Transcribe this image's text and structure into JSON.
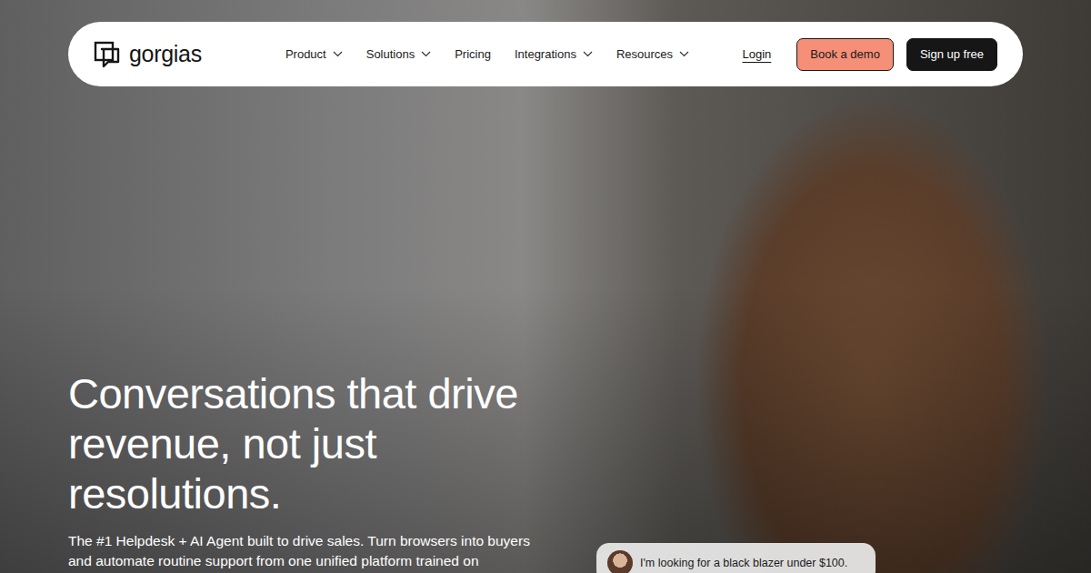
{
  "nav": {
    "logo": "gorgias",
    "items": [
      {
        "label": "Product",
        "kind": "dropdown"
      },
      {
        "label": "Solutions",
        "kind": "dropdown"
      },
      {
        "label": "Pricing",
        "kind": "link"
      },
      {
        "label": "Integrations",
        "kind": "dropdown"
      },
      {
        "label": "Resources",
        "kind": "dropdown"
      }
    ],
    "login": "Login",
    "book_demo": "Book a demo",
    "signup": "Sign up free"
  },
  "hero": {
    "headline": "Conversations that drive revenue, not just resolutions.",
    "subtext": "The #1 Helpdesk + AI Agent built to drive sales. Turn browsers into buyers and automate routine support from one unified platform trained on"
  },
  "chat": {
    "message": "I'm looking for a black blazer under $100."
  }
}
